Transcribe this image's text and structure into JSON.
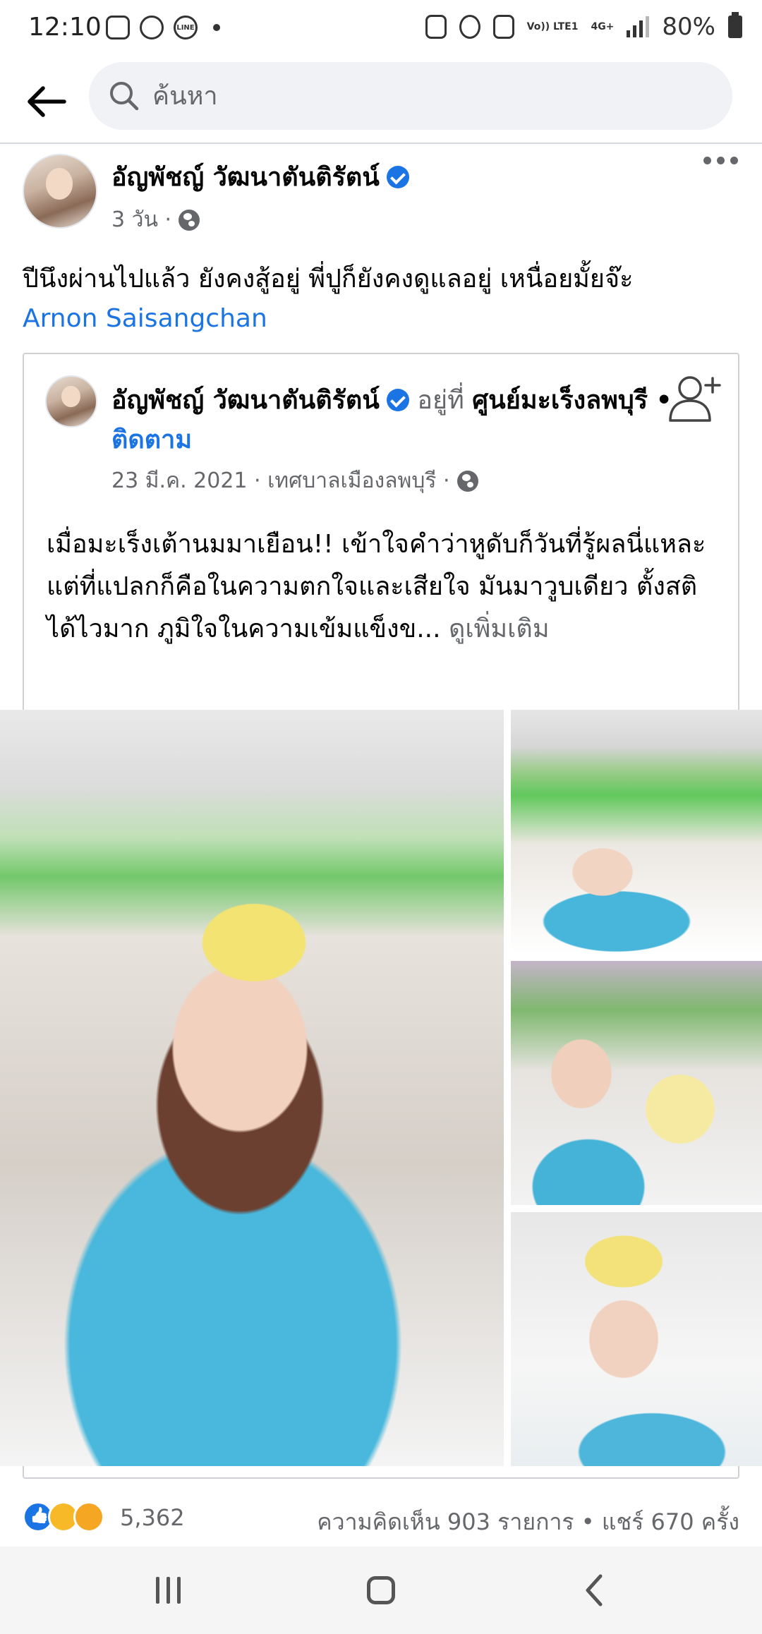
{
  "status_bar": {
    "time": "12:10",
    "notification_icons": [
      "instagram-icon",
      "messenger-icon",
      "line-icon"
    ],
    "line_label": "LINE",
    "network": "Vo)) LTE1",
    "network_gen": "4G+",
    "battery": "80%"
  },
  "search": {
    "placeholder": "ค้นหา"
  },
  "post": {
    "author": "อัญพัชญ์ วัฒนาตันติรัตน์",
    "time": "3 วัน ·",
    "text": "ปีนึงผ่านไปแล้ว ยังคงสู้อยู่ พี่ปูก็ยังคงดูแลอยู่ เหนื่อยมั้ยจ๊ะ",
    "mention": "Arnon Saisangchan"
  },
  "shared": {
    "author": "อัญพัชญ์ วัฒนาตันติรัตน์",
    "at_label": "อยู่ที่",
    "place": "ศูนย์มะเร็งลพบุรี",
    "separator": "•",
    "follow": "ติดตาม",
    "meta": "23 มี.ค. 2021 · เทศบาลเมืองลพบุรี ·",
    "text": "เมื่อมะเร็งเต้านมมาเยือน!! เข้าใจคำว่าหูดับก็วันที่รู้ผลนี่แหละ แต่ที่แปลกก็คือในความตกใจและเสียใจ มันมาวูบเดียว ตั้งสติได้ไวมาก ภูมิใจในความเข้มแข็งข...",
    "see_more": "ดูเพิ่มเติม"
  },
  "reactions": {
    "types": [
      "like",
      "sad",
      "care"
    ],
    "count": "5,362",
    "comments_shares": "ความคิดเห็น 903 รายการ • แชร์ 670 ครั้ง"
  },
  "colors": {
    "link": "#1b74e4",
    "secondary_text": "#65676b",
    "search_bg": "#f0f2f5"
  }
}
